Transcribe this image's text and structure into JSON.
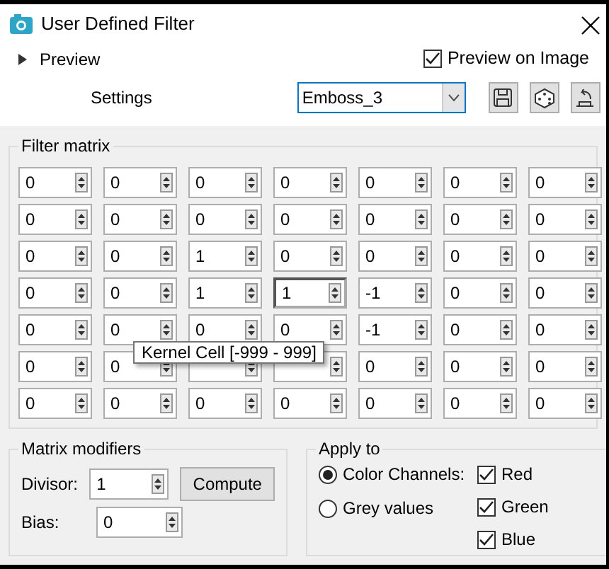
{
  "window": {
    "title": "User Defined Filter"
  },
  "preview": {
    "label": "Preview",
    "expanded": false
  },
  "preview_on_image": {
    "label": "Preview on Image",
    "checked": true
  },
  "settings": {
    "label": "Settings",
    "value": "Emboss_3"
  },
  "filter_matrix": {
    "title": "Filter matrix",
    "rows": [
      [
        {
          "value": "0",
          "focused": false
        },
        {
          "value": "0",
          "focused": false
        },
        {
          "value": "0",
          "focused": false
        },
        {
          "value": "0",
          "focused": false
        },
        {
          "value": "0",
          "focused": false
        },
        {
          "value": "0",
          "focused": false
        },
        {
          "value": "0",
          "focused": false
        }
      ],
      [
        {
          "value": "0",
          "focused": false
        },
        {
          "value": "0",
          "focused": false
        },
        {
          "value": "0",
          "focused": false
        },
        {
          "value": "0",
          "focused": false
        },
        {
          "value": "0",
          "focused": false
        },
        {
          "value": "0",
          "focused": false
        },
        {
          "value": "0",
          "focused": false
        }
      ],
      [
        {
          "value": "0",
          "focused": false
        },
        {
          "value": "0",
          "focused": false
        },
        {
          "value": "1",
          "focused": false
        },
        {
          "value": "0",
          "focused": false
        },
        {
          "value": "0",
          "focused": false
        },
        {
          "value": "0",
          "focused": false
        },
        {
          "value": "0",
          "focused": false
        }
      ],
      [
        {
          "value": "0",
          "focused": false
        },
        {
          "value": "0",
          "focused": false
        },
        {
          "value": "1",
          "focused": false
        },
        {
          "value": "1",
          "focused": true
        },
        {
          "value": "-1",
          "focused": false
        },
        {
          "value": "0",
          "focused": false
        },
        {
          "value": "0",
          "focused": false
        }
      ],
      [
        {
          "value": "0",
          "focused": false
        },
        {
          "value": "0",
          "focused": false
        },
        {
          "value": "0",
          "focused": false
        },
        {
          "value": "0",
          "focused": false
        },
        {
          "value": "-1",
          "focused": false
        },
        {
          "value": "0",
          "focused": false
        },
        {
          "value": "0",
          "focused": false
        }
      ],
      [
        {
          "value": "0",
          "focused": false
        },
        {
          "value": "0",
          "focused": false
        },
        {
          "focused": false
        },
        {
          "focused": false
        },
        {
          "value": "0",
          "focused": false
        },
        {
          "value": "0",
          "focused": false
        },
        {
          "value": "0",
          "focused": false
        }
      ],
      [
        {
          "value": "0",
          "focused": false
        },
        {
          "value": "0",
          "focused": false
        },
        {
          "value": "0",
          "focused": false
        },
        {
          "value": "0",
          "focused": false
        },
        {
          "value": "0",
          "focused": false
        },
        {
          "value": "0",
          "focused": false
        },
        {
          "value": "0",
          "focused": false
        }
      ]
    ],
    "tooltip": "Kernel Cell [-999 - 999]"
  },
  "matrix_modifiers": {
    "title": "Matrix modifiers",
    "divisor": {
      "label": "Divisor:",
      "value": "1"
    },
    "bias": {
      "label": "Bias:",
      "value": "0"
    },
    "compute": "Compute"
  },
  "apply_to": {
    "title": "Apply to",
    "modes": [
      {
        "label": "Color Channels:",
        "selected": true
      },
      {
        "label": "Grey values",
        "selected": false
      }
    ],
    "channels": [
      {
        "label": "Red",
        "checked": true
      },
      {
        "label": "Green",
        "checked": true
      },
      {
        "label": "Blue",
        "checked": true
      }
    ]
  }
}
